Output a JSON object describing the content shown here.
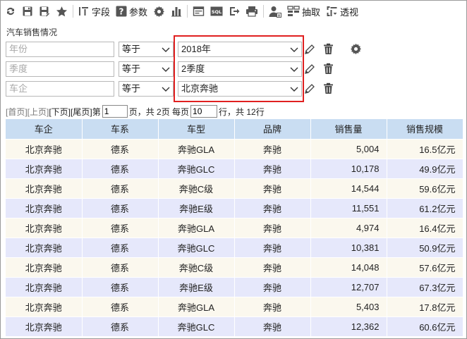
{
  "toolbar": {
    "fields_label": "字段",
    "params_label": "参数",
    "sql_label": "SQL",
    "extract_label": "抽取",
    "pivot_label": "透视"
  },
  "report": {
    "title": "汽车销售情况"
  },
  "filters": [
    {
      "field": "年份",
      "operator": "等于",
      "value": "2018年"
    },
    {
      "field": "季度",
      "operator": "等于",
      "value": "2季度"
    },
    {
      "field": "车企",
      "operator": "等于",
      "value": "北京奔驰"
    }
  ],
  "pager": {
    "first": "[首页]",
    "prev": "[上页]",
    "next": "[下页]",
    "last": "[尾页]",
    "page_prefix": "第",
    "current_page": "1",
    "total_text": "页，共 2页 每页",
    "page_size": "10",
    "rows_text": "行，共 12行"
  },
  "table": {
    "columns": [
      "车企",
      "车系",
      "车型",
      "品牌",
      "销售量",
      "销售规模"
    ],
    "rows": [
      [
        "北京奔驰",
        "德系",
        "奔驰GLA",
        "奔驰",
        "5,004",
        "16.5亿元"
      ],
      [
        "北京奔驰",
        "德系",
        "奔驰GLC",
        "奔驰",
        "10,178",
        "49.9亿元"
      ],
      [
        "北京奔驰",
        "德系",
        "奔驰C级",
        "奔驰",
        "14,544",
        "59.6亿元"
      ],
      [
        "北京奔驰",
        "德系",
        "奔驰E级",
        "奔驰",
        "11,551",
        "61.2亿元"
      ],
      [
        "北京奔驰",
        "德系",
        "奔驰GLA",
        "奔驰",
        "4,974",
        "16.4亿元"
      ],
      [
        "北京奔驰",
        "德系",
        "奔驰GLC",
        "奔驰",
        "10,381",
        "50.9亿元"
      ],
      [
        "北京奔驰",
        "德系",
        "奔驰C级",
        "奔驰",
        "14,048",
        "57.6亿元"
      ],
      [
        "北京奔驰",
        "德系",
        "奔驰E级",
        "奔驰",
        "12,707",
        "67.3亿元"
      ],
      [
        "北京奔驰",
        "德系",
        "奔驰GLA",
        "奔驰",
        "5,403",
        "17.8亿元"
      ],
      [
        "北京奔驰",
        "德系",
        "奔驰GLC",
        "奔驰",
        "12,362",
        "60.6亿元"
      ]
    ]
  },
  "colors": {
    "header_bg": "#c9ddf2",
    "row_odd": "#fbf8ee",
    "row_even": "#e6e8fb",
    "highlight": "#e02020"
  }
}
